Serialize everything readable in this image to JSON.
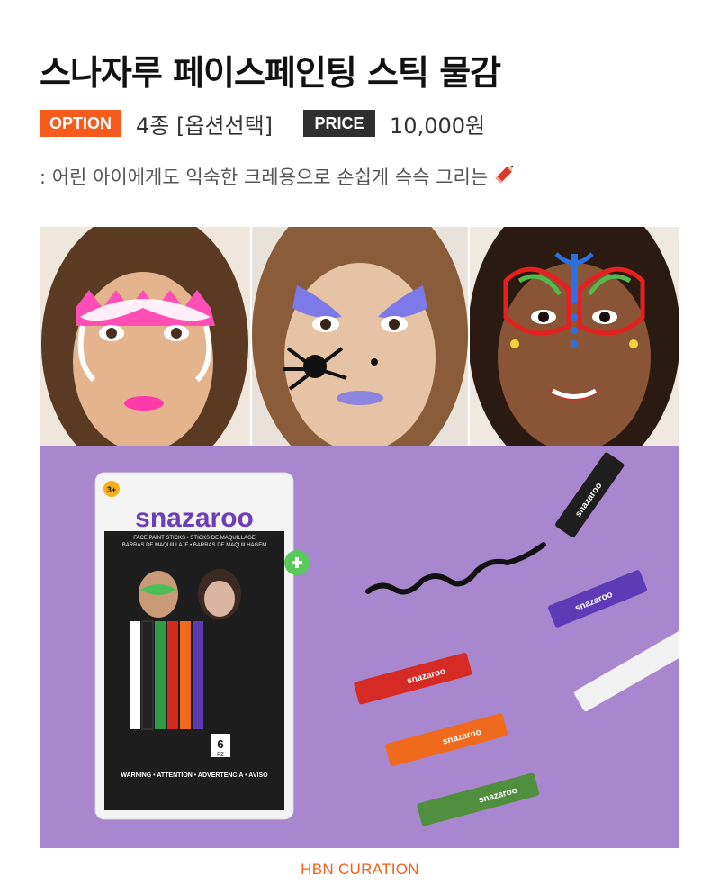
{
  "product": {
    "title": "스나자루 페이스페인팅 스틱 물감",
    "option_label": "OPTION",
    "option_value": "4종 [옵션선택]",
    "price_label": "PRICE",
    "price_value": "10,000원",
    "description": ": 어린 아이에게도 익숙한 크레용으로 손쉽게 슥슥 그리는",
    "description_icon": "pencil-crayon-icon"
  },
  "package": {
    "age_badge": "3+",
    "brand": "snazaroo",
    "subtitle_1": "FACE PAINT STICKS • STICKS DE MAQUILLAGE",
    "subtitle_2": "BARRAS DE MAQUILLAJE • BARRAS DE MAQUILHAGEM",
    "count": "6",
    "count_unit": "PZ",
    "warning": "WARNING • ATTENTION • ADVERTENCIA • AVISO",
    "plus_icon": "plus-circle-icon"
  },
  "stick_labels": {
    "brand": "snazaroo"
  },
  "colors": {
    "accent": "#f45b1c",
    "price_badge": "#2f2f2f",
    "purple_bg": "#a987cf",
    "plus_green": "#58c95a"
  },
  "footer": {
    "label": "HBN CURATION"
  }
}
